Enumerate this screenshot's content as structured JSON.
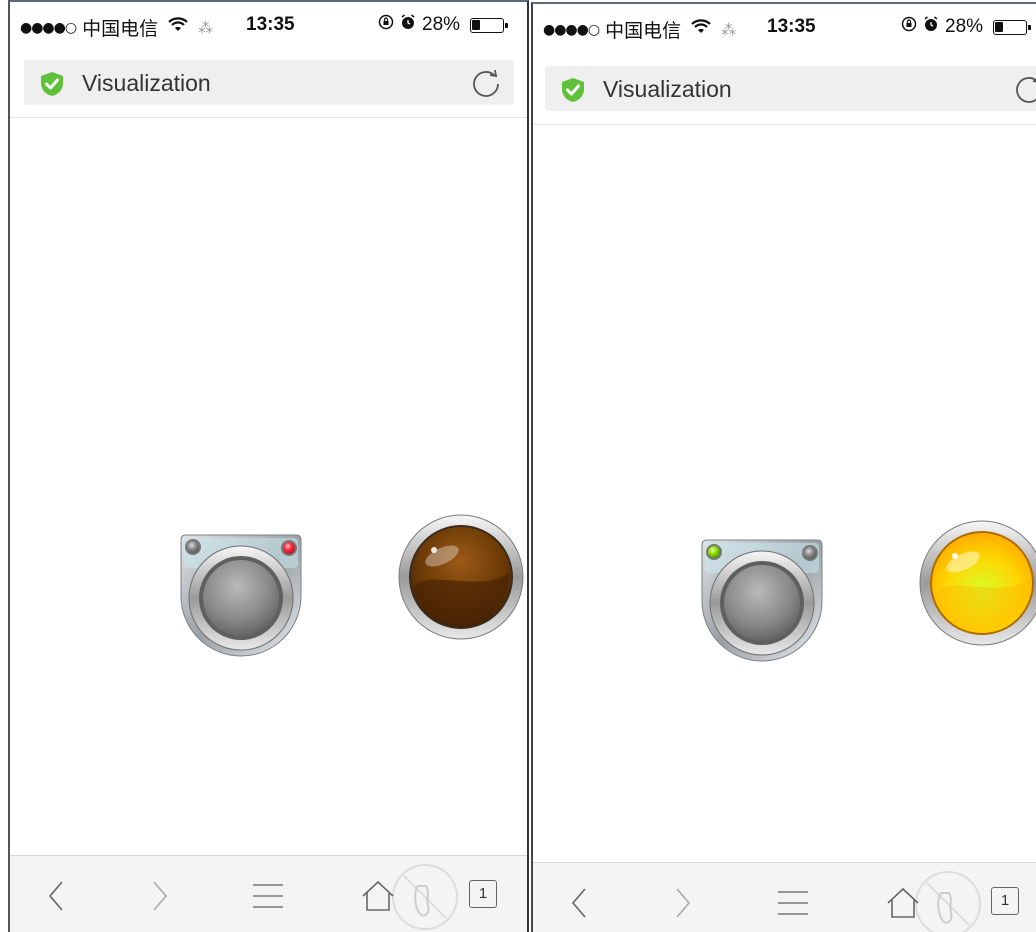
{
  "screens": [
    {
      "status": {
        "signal": "●●●●○",
        "carrier": "中国电信",
        "wifi_icon": "wifi-icon",
        "time": "13:35",
        "battery": "28%",
        "battery_level": 0.28
      },
      "address_bar": {
        "title": "Visualization",
        "secure_icon": "shield-check-icon",
        "reload_icon": "reload-icon"
      },
      "push_button": {
        "left_led": "off",
        "right_led": "red",
        "left_led_color": "#8a8a8a",
        "right_led_color": "#ff3344"
      },
      "lamp": {
        "state": "off",
        "color": "#6b3a06"
      },
      "toolbar": {
        "back_icon": "back-icon",
        "forward_icon": "forward-icon",
        "menu_icon": "menu-icon",
        "home_icon": "home-icon",
        "tabs_count": "1"
      }
    },
    {
      "status": {
        "signal": "●●●●○",
        "carrier": "中国电信",
        "wifi_icon": "wifi-icon",
        "time": "13:35",
        "battery": "28%",
        "battery_level": 0.28
      },
      "address_bar": {
        "title": "Visualization",
        "secure_icon": "shield-check-icon",
        "reload_icon": "reload-icon"
      },
      "push_button": {
        "left_led": "green",
        "right_led": "off",
        "left_led_color": "#8fe000",
        "right_led_color": "#8a8a8a"
      },
      "lamp": {
        "state": "on",
        "color": "#ffd400"
      },
      "toolbar": {
        "back_icon": "back-icon",
        "forward_icon": "forward-icon",
        "menu_icon": "menu-icon",
        "home_icon": "home-icon",
        "tabs_count": "1"
      }
    }
  ],
  "colors": {
    "accent_green": "#5fc13a",
    "lamp_off": "#6b3a06",
    "lamp_on": "#ffd400",
    "led_red": "#ff3344",
    "led_green": "#8fe000"
  }
}
